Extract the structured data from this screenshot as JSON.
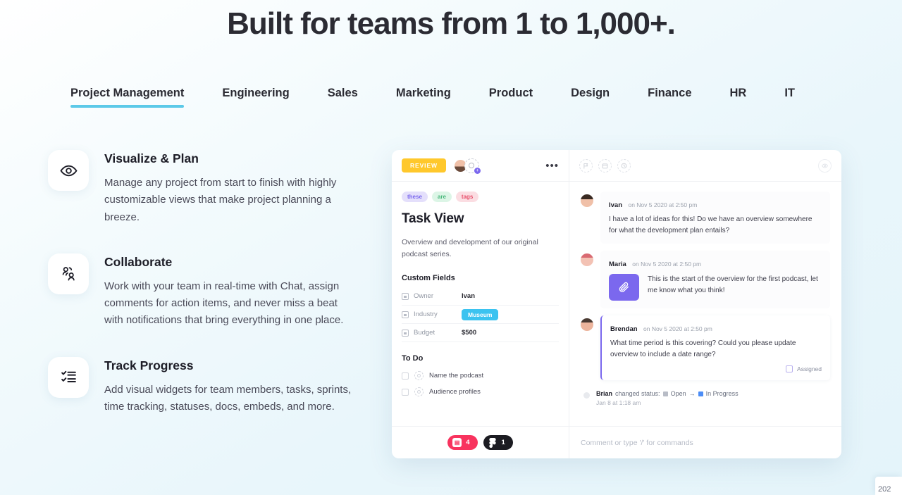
{
  "headline": "Built for teams from 1 to 1,000+.",
  "tabs": [
    {
      "label": "Project Management",
      "active": true
    },
    {
      "label": "Engineering",
      "active": false
    },
    {
      "label": "Sales",
      "active": false
    },
    {
      "label": "Marketing",
      "active": false
    },
    {
      "label": "Product",
      "active": false
    },
    {
      "label": "Design",
      "active": false
    },
    {
      "label": "Finance",
      "active": false
    },
    {
      "label": "HR",
      "active": false
    },
    {
      "label": "IT",
      "active": false
    }
  ],
  "accent_color": "#5cc9e8",
  "features": [
    {
      "icon": "eye-icon",
      "title": "Visualize & Plan",
      "description": "Manage any project from start to finish with highly customizable views that make project planning a breeze."
    },
    {
      "icon": "collaborate-people-icon",
      "title": "Collaborate",
      "description": "Work with your team in real-time with Chat, assign comments for action items, and never miss a beat with notifications that bring everything in one place."
    },
    {
      "icon": "checklist-icon",
      "title": "Track Progress",
      "description": "Add visual widgets for team members, tasks, sprints, time tracking, statuses, docs, embeds, and more."
    }
  ],
  "app": {
    "task": {
      "status_badge": "REVIEW",
      "more_button": "•••",
      "tags": [
        {
          "label": "these",
          "color": "#7b68ee"
        },
        {
          "label": "are",
          "color": "#4bb87d"
        },
        {
          "label": "tags",
          "color": "#e8526d"
        }
      ],
      "title": "Task View",
      "description": "Overview and development of our original podcast series.",
      "custom_fields_heading": "Custom Fields",
      "custom_fields": [
        {
          "label": "Owner",
          "value": "Ivan",
          "type": "text"
        },
        {
          "label": "Industry",
          "value": "Museum",
          "type": "pill"
        },
        {
          "label": "Budget",
          "value": "$500",
          "type": "text"
        }
      ],
      "todo_heading": "To Do",
      "todos": [
        {
          "label": "Name the podcast",
          "checked": false
        },
        {
          "label": "Audience profiles",
          "checked": false
        }
      ],
      "badges": [
        {
          "icon": "image-icon",
          "count": "4",
          "color": "#f8335e"
        },
        {
          "icon": "figma-icon",
          "count": "1",
          "color": "#1c1c22"
        }
      ]
    },
    "comments": {
      "toolbar_icons": [
        "flag-icon",
        "calendar-icon",
        "clock-icon"
      ],
      "watch_icon": "eye-icon",
      "items": [
        {
          "author": "Ivan",
          "meta": "on Nov 5 2020 at 2:50 pm",
          "text": "I have a lot of ideas for this! Do we have an overview somewhere for what the development plan entails?",
          "attachment": null,
          "highlighted": false,
          "assigned_label": null
        },
        {
          "author": "Maria",
          "meta": "on Nov 5 2020 at 2:50 pm",
          "text": "This is the start of the overview for the first podcast, let me know what you think!",
          "attachment": "paperclip-icon",
          "highlighted": false,
          "assigned_label": null
        },
        {
          "author": "Brendan",
          "meta": "on Nov 5 2020 at 2:50 pm",
          "text": "What time period is this covering? Could you please update overview to include a date range?",
          "attachment": null,
          "highlighted": true,
          "assigned_label": "Assigned"
        }
      ],
      "status_change": {
        "author": "Brian",
        "action": "changed status:",
        "from": "Open",
        "arrow": "→",
        "to": "In Progress",
        "time": "Jan 8 at 1:18 am"
      },
      "input_placeholder": "Comment or type '/' for commands"
    }
  },
  "corner_widget": "202"
}
